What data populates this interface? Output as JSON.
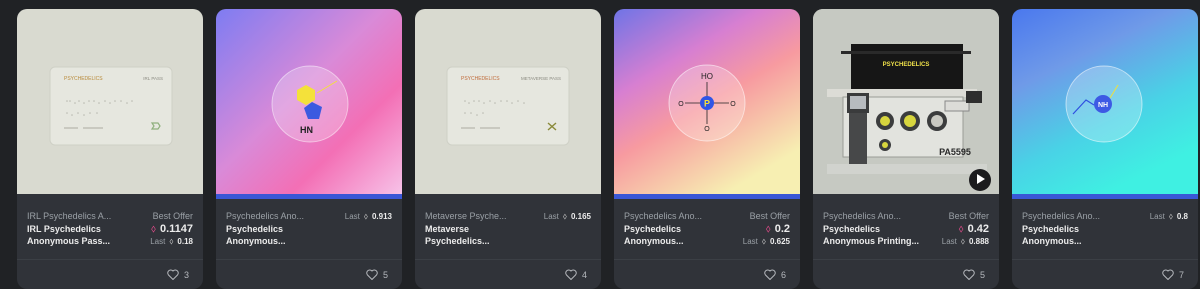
{
  "cards": [
    {
      "artwork": "irl-pass-card",
      "card_brand": "PSYCHEDELICS",
      "card_title": "IRL PASS",
      "collection": "IRL Psychedelics A...",
      "name": "IRL Psychedelics\nAnonymous Pass...",
      "price_label": "Best Offer",
      "price": "0.1147",
      "last_label": "Last",
      "last": "0.18",
      "likes": "3"
    },
    {
      "artwork": "molecule-hn",
      "molecule_label": "HN",
      "collection": "Psychedelics Ano...",
      "name": "Psychedelics\nAnonymous...",
      "last_label": "Last",
      "last": "0.913",
      "likes": "5"
    },
    {
      "artwork": "metaverse-pass-card",
      "card_brand": "PSYCHEDELICS",
      "card_title": "METAVERSE PASS",
      "collection": "Metaverse Psyche...",
      "name": "Metaverse\nPsychedelics...",
      "last_label": "Last",
      "last": "0.165",
      "likes": "4"
    },
    {
      "artwork": "molecule-ho-p",
      "molecule_label": "HO",
      "molecule_letter": "P",
      "molecule_o1": "O",
      "molecule_o2": "O",
      "molecule_o3": "O",
      "collection": "Psychedelics Ano...",
      "name": "Psychedelics\nAnonymous...",
      "price_label": "Best Offer",
      "price": "0.2",
      "last_label": "Last",
      "last": "0.625",
      "likes": "6"
    },
    {
      "artwork": "printing-press-machine",
      "banner_text": "PSYCHEDELICS",
      "machine_text": "PA5595",
      "collection": "Psychedelics Ano...",
      "name": "Psychedelics\nAnonymous Printing...",
      "price_label": "Best Offer",
      "price": "0.42",
      "last_label": "Last",
      "last": "0.888",
      "likes": "5"
    },
    {
      "artwork": "molecule-nh",
      "molecule_label": "NH",
      "collection": "Psychedelics Ano...",
      "name": "Psychedelics\nAnonymous...",
      "last_label": "Last",
      "last": "0.8",
      "likes": "7"
    }
  ],
  "colors": {
    "page_bg": "#202225",
    "card_bg": "#303339",
    "accent_bar": "#3a57d6",
    "eth_offer": "#e24b8a"
  },
  "icons": [
    "ethereum-icon",
    "heart-icon",
    "play-icon"
  ]
}
